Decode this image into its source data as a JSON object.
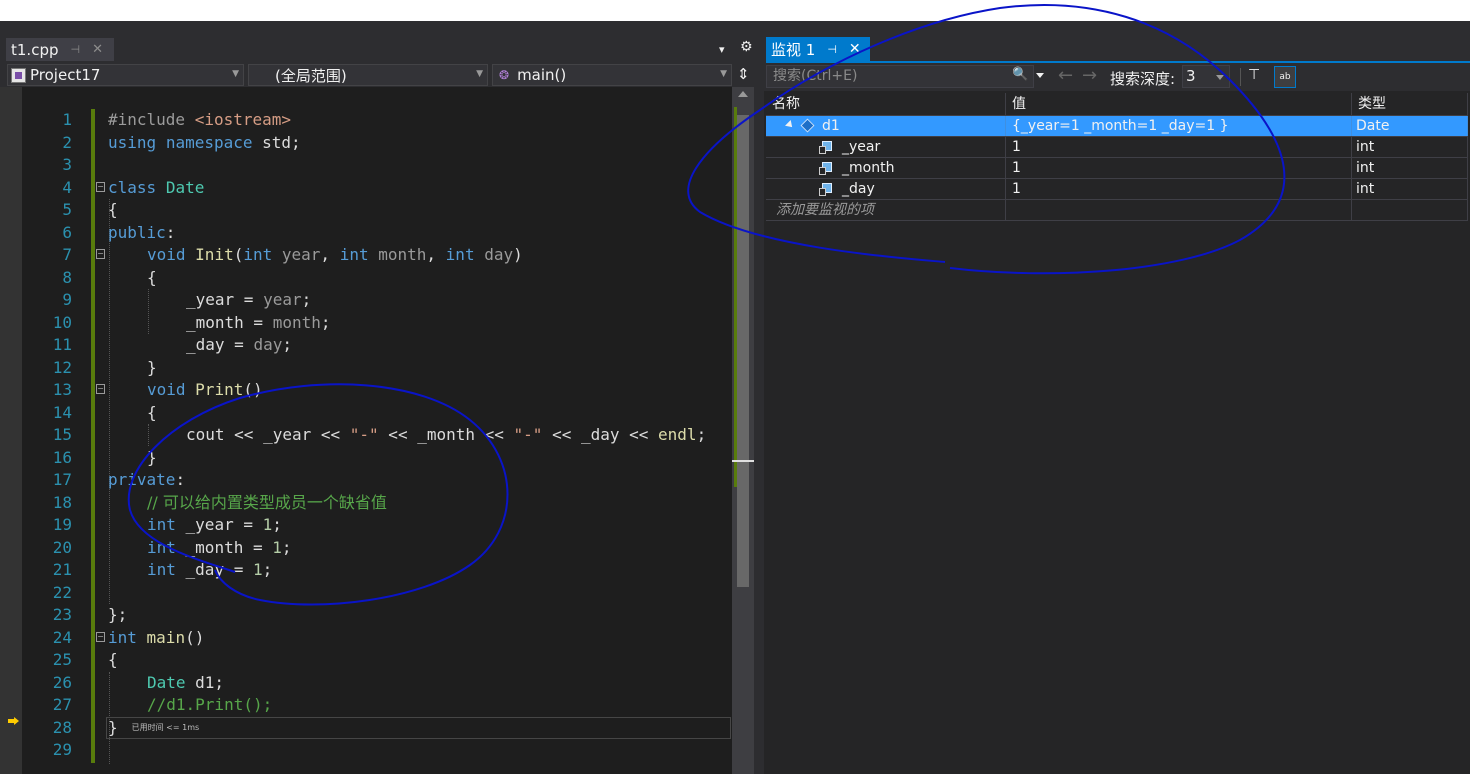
{
  "editor": {
    "tab": {
      "title": "t1.cpp",
      "pin": "⊣",
      "close": "✕"
    },
    "toolbar": {
      "dropdown": "▾",
      "gear": "⚙"
    },
    "nav": {
      "project": "Project17",
      "scope": "(全局范围)",
      "function": "main()",
      "split": "⇕"
    },
    "elapsed": "已用时间 <= 1ms",
    "lines": [
      {
        "n": "1"
      },
      {
        "n": "2"
      },
      {
        "n": "3"
      },
      {
        "n": "4"
      },
      {
        "n": "5"
      },
      {
        "n": "6"
      },
      {
        "n": "7"
      },
      {
        "n": "8"
      },
      {
        "n": "9"
      },
      {
        "n": "10"
      },
      {
        "n": "11"
      },
      {
        "n": "12"
      },
      {
        "n": "13"
      },
      {
        "n": "14"
      },
      {
        "n": "15"
      },
      {
        "n": "16"
      },
      {
        "n": "17"
      },
      {
        "n": "18"
      },
      {
        "n": "19"
      },
      {
        "n": "20"
      },
      {
        "n": "21"
      },
      {
        "n": "22"
      },
      {
        "n": "23"
      },
      {
        "n": "24"
      },
      {
        "n": "25"
      },
      {
        "n": "26"
      },
      {
        "n": "27"
      },
      {
        "n": "28"
      },
      {
        "n": "29"
      }
    ],
    "code": {
      "l1_pp": "#include ",
      "l1_hdr": "<iostream>",
      "l2_kw1": "using",
      "l2_kw2": "namespace",
      "l2_rest": " std;",
      "l4_kw": "class",
      "l4_ty": "Date",
      "l5": "{",
      "l6_kw": "public",
      "l6_p": ":",
      "l7_kw": "void",
      "l7_fn": "Init",
      "l7_a": "(",
      "l7_t1": "int",
      "l7_p1": "year",
      "l7_c1": ", ",
      "l7_t2": "int",
      "l7_p2": "month",
      "l7_c2": ", ",
      "l7_t3": "int",
      "l7_p3": "day",
      "l7_b": ")",
      "l8": "{",
      "l9_m": "_year",
      "l9_eq": " = ",
      "l9_p": "year",
      "l9_s": ";",
      "l10_m": "_month",
      "l10_eq": " = ",
      "l10_p": "month",
      "l10_s": ";",
      "l11_m": "_day",
      "l11_eq": " = ",
      "l11_p": "day",
      "l11_s": ";",
      "l12": "}",
      "l13_kw": "void",
      "l13_fn": "Print",
      "l13_b": "()",
      "l14": "{",
      "l15_a": "cout << _year << ",
      "l15_s1": "\"-\"",
      "l15_b": " << _month << ",
      "l15_s2": "\"-\"",
      "l15_c": " << _day << ",
      "l15_fn": "endl",
      "l15_e": ";",
      "l16": "}",
      "l17_kw": "private",
      "l17_p": ":",
      "l18": "// 可以给内置类型成员一个缺省值",
      "l19_kw": "int",
      "l19_m": " _year = ",
      "l19_n": "1",
      "l19_s": ";",
      "l20_kw": "int",
      "l20_m": " _month = ",
      "l20_n": "1",
      "l20_s": ";",
      "l21_kw": "int",
      "l21_m": " _day = ",
      "l21_n": "1",
      "l21_s": ";",
      "l23": "};",
      "l24_kw": "int",
      "l24_fn": " main",
      "l24_b": "()",
      "l25": "{",
      "l26_ty": "Date",
      "l26_r": " d1;",
      "l27": "//d1.Print();",
      "l28": "}"
    }
  },
  "watch": {
    "tab": {
      "title": "监视 1",
      "pin": "⊣",
      "close": "✕"
    },
    "search_placeholder": "搜索(Ctrl+E)",
    "search_icon": "🔍",
    "back": "←",
    "forward": "→",
    "depth_label": "搜索深度:",
    "depth_value": "3",
    "filter_icon": "⊤",
    "hex_icon": "ab",
    "columns": {
      "name": "名称",
      "value": "值",
      "type": "类型"
    },
    "rows": [
      {
        "name": "d1",
        "value": "{_year=1 _month=1 _day=1 }",
        "type": "Date"
      },
      {
        "name": "_year",
        "value": "1",
        "type": "int"
      },
      {
        "name": "_month",
        "value": "1",
        "type": "int"
      },
      {
        "name": "_day",
        "value": "1",
        "type": "int"
      }
    ],
    "add_item": "添加要监视的项"
  },
  "annotations": {
    "stroke_color": "#0a14c8"
  }
}
